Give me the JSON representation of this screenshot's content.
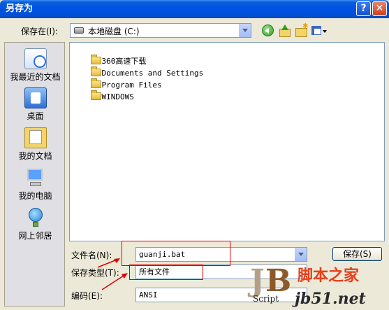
{
  "window": {
    "title": "另存为",
    "help_label": "?",
    "close_label": "✕"
  },
  "toolbar": {
    "save_in_label": "保存在(I):",
    "save_in_value": "本地磁盘 (C:)"
  },
  "places": [
    {
      "label": "我最近的文档",
      "icon": "recent-documents-icon"
    },
    {
      "label": "桌面",
      "icon": "desktop-icon"
    },
    {
      "label": "我的文档",
      "icon": "my-documents-icon"
    },
    {
      "label": "我的电脑",
      "icon": "my-computer-icon"
    },
    {
      "label": "网上邻居",
      "icon": "network-places-icon"
    }
  ],
  "files": [
    {
      "name": "360高速下载"
    },
    {
      "name": "Documents and Settings"
    },
    {
      "name": "Program Files"
    },
    {
      "name": "WINDOWS"
    }
  ],
  "form": {
    "filename_label": "文件名(N):",
    "filename_value": "guanji.bat",
    "filetype_label": "保存类型(T):",
    "filetype_value": "所有文件",
    "encoding_label": "编码(E):",
    "encoding_value": "ANSI",
    "save_button": "保存(S)"
  },
  "watermark": {
    "logo_text": "JB",
    "logo_sub": "Script",
    "site_cn": "脚本之家",
    "site_url": "jb51.net"
  },
  "colors": {
    "annotation": "#e00000",
    "titlebar": "#0054e3"
  }
}
